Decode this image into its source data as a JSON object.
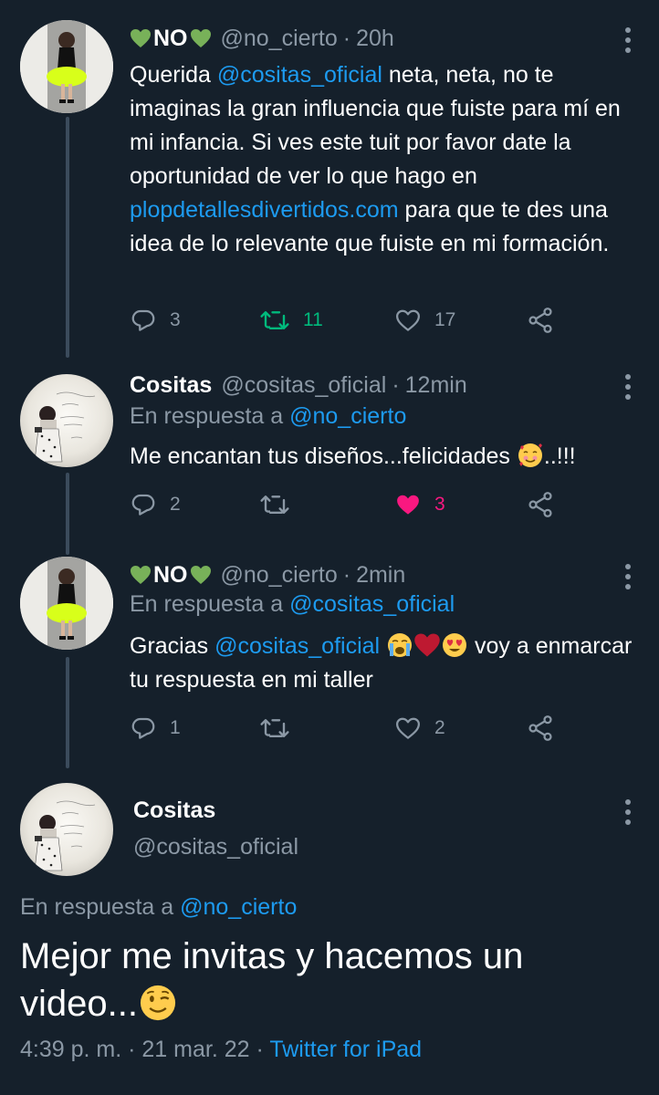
{
  "tweets": [
    {
      "name": "NO",
      "handle": "@no_cierto",
      "time": "20h",
      "text_parts": [
        "Querida ",
        "@cositas_oficial",
        " neta,  neta, no te imaginas la gran influencia que fuiste para mí en mi infancia.  Si ves este tuit por favor date la oportunidad de ver lo que hago en ",
        "plopdetallesdivertidos.com",
        "  para que te des una idea de lo relevante que fuiste en mi formación."
      ],
      "replies": "3",
      "retweets": "11",
      "likes": "17"
    },
    {
      "name": "Cositas",
      "handle": "@cositas_oficial",
      "time": "12min",
      "reply_label": "En respuesta a",
      "reply_to": "@no_cierto",
      "text": "Me encantan tus diseños...felicidades ",
      "text_tail": "..!!!",
      "replies": "2",
      "likes": "3"
    },
    {
      "name": "NO",
      "handle": "@no_cierto",
      "time": "2min",
      "reply_label": "En respuesta a",
      "reply_to": "@cositas_oficial",
      "text_prefix": "Gracias ",
      "mention": "@cositas_oficial",
      "text_tail": " voy a enmarcar tu respuesta en mi taller",
      "replies": "1",
      "likes": "2"
    }
  ],
  "main_tweet": {
    "name": "Cositas",
    "handle": "@cositas_oficial",
    "reply_label": "En respuesta a",
    "reply_to": "@no_cierto",
    "text": "Mejor me invitas y hacemos un video...",
    "time": "4:39 p. m.",
    "date": "21 mar. 22",
    "source": "Twitter for iPad"
  },
  "colors": {
    "background": "#15202b",
    "link": "#1d9bf0",
    "muted": "#8b98a5",
    "retweet_active": "#00ba7c",
    "like_active": "#f91880",
    "green_heart": "#78b159"
  },
  "icons": [
    "green-heart-icon",
    "more-icon",
    "reply-icon",
    "retweet-icon",
    "like-icon",
    "share-icon",
    "smiling-hearts-emoji",
    "crying-emoji",
    "red-heart-emoji",
    "heart-eyes-emoji",
    "winking-emoji"
  ]
}
